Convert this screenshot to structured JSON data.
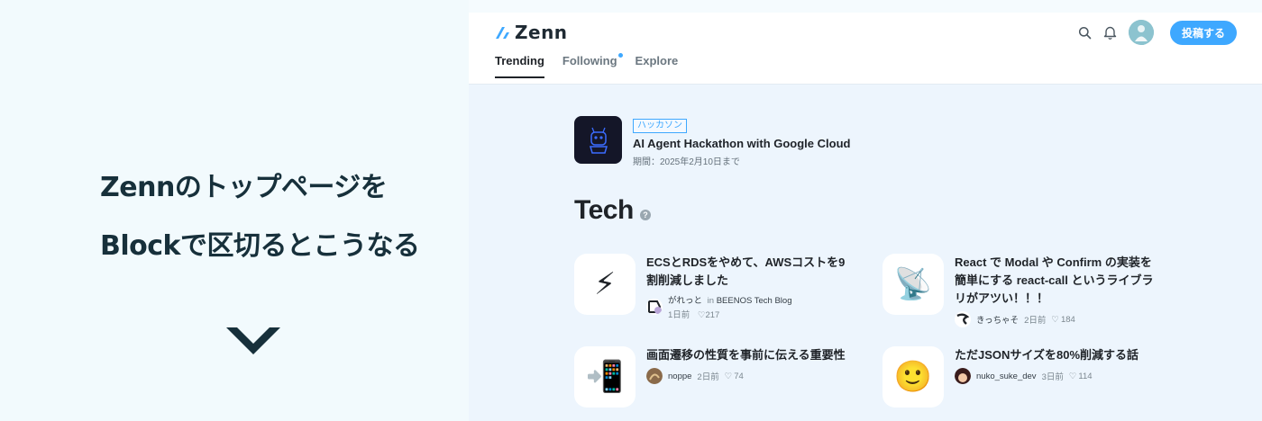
{
  "caption": {
    "line1": "Zennのトップページを",
    "line2": "Blockで区切るとこうなる"
  },
  "header": {
    "logo_text": "Zenn",
    "post_button": "投稿する",
    "tabs": [
      {
        "label": "Trending",
        "active": true
      },
      {
        "label": "Following",
        "has_dot": true
      },
      {
        "label": "Explore"
      }
    ]
  },
  "event": {
    "badge": "ハッカソン",
    "title": "AI Agent Hackathon with Google Cloud",
    "period": "期間：2025年2月10日まで"
  },
  "section": {
    "title": "Tech",
    "help": "?"
  },
  "articles": [
    {
      "title": "ECSとRDSをやめて、AWSコストを9割削減しました",
      "author": "がれっと",
      "in_label": "in",
      "publication": "BEENOS Tech Blog",
      "date": "1日前",
      "likes": "217",
      "icon": "lightning-emoji"
    },
    {
      "title": "React で Modal や Confirm の実装を簡単にする react-call というライブラリがアツい！！！",
      "author": "きっちゃそ",
      "date": "2日前",
      "likes": "184",
      "icon": "satellite-dish-emoji"
    },
    {
      "title": "画面遷移の性質を事前に伝える重要性",
      "author": "noppe",
      "date": "2日前",
      "likes": "74",
      "icon": "mobile-arrow-emoji"
    },
    {
      "title": "ただJSONサイズを80%削減する話",
      "author": "nuko_suke_dev",
      "date": "3日前",
      "likes": "114",
      "icon": "smiley-emoji"
    }
  ],
  "colors": {
    "accent": "#3ea8ff",
    "caption_text": "#17303b",
    "app_background": "#edf5fd"
  }
}
